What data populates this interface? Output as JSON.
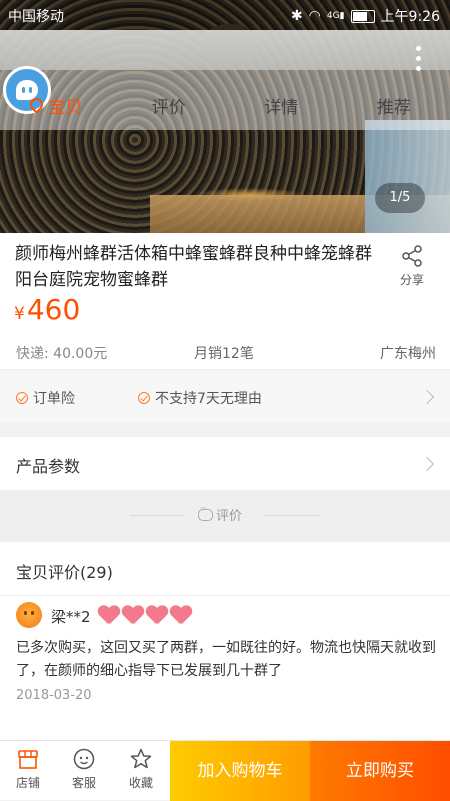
{
  "status": {
    "carrier": "中国移动",
    "signal_label": "4G",
    "time": "上午9:26"
  },
  "tabs": [
    {
      "label": "宝贝"
    },
    {
      "label": "评价"
    },
    {
      "label": "详情"
    },
    {
      "label": "推荐"
    }
  ],
  "gallery": {
    "pager": "1/5"
  },
  "product": {
    "title": "颜师梅州蜂群活体箱中蜂蜜蜂群良种中蜂笼蜂群阳台庭院宠物蜜蜂群",
    "share_label": "分享",
    "currency": "¥",
    "price": "460",
    "shipping": "快递: 40.00元",
    "monthly_sales": "月销12笔",
    "location": "广东梅州"
  },
  "guarantees": [
    {
      "label": "订单险"
    },
    {
      "label": "不支持7天无理由"
    }
  ],
  "params": {
    "label": "产品参数"
  },
  "divider": {
    "label": "评价"
  },
  "reviews": {
    "heading": "宝贝评价(29)",
    "items": [
      {
        "user": "梁**2",
        "text": "已多次购买，这回又买了两群，一如既往的好。物流也快隔天就收到了，在颜师的细心指导下已发展到几十群了",
        "date": "2018-03-20"
      }
    ]
  },
  "bottom": {
    "shop": "店铺",
    "service": "客服",
    "favorite": "收藏",
    "add_to_cart": "加入购物车",
    "buy_now": "立即购买"
  },
  "colors": {
    "accent": "#ff5000",
    "cart": "#ffb300",
    "buy": "#ff5a00"
  }
}
